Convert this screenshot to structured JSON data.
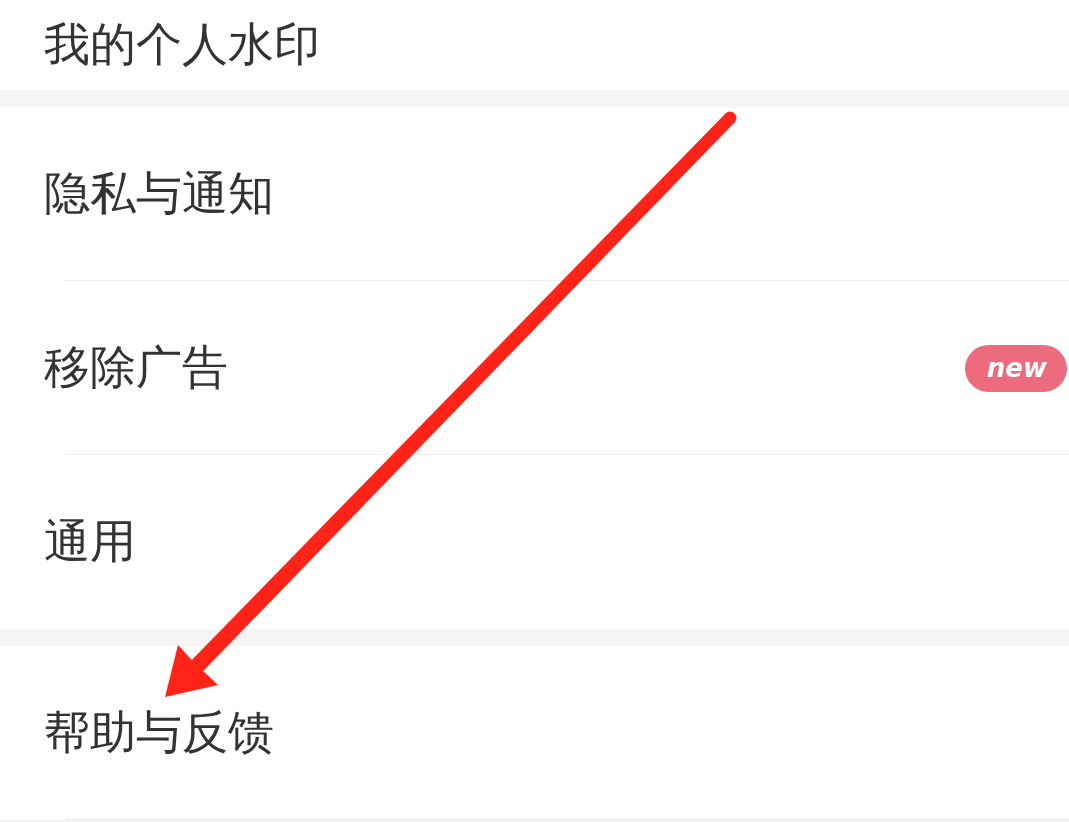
{
  "sections": [
    {
      "items": [
        {
          "label": "我的个人水印"
        }
      ]
    },
    {
      "items": [
        {
          "label": "隐私与通知"
        },
        {
          "label": "移除广告",
          "badge": "new"
        },
        {
          "label": "通用"
        }
      ]
    },
    {
      "items": [
        {
          "label": "帮助与反馈"
        }
      ]
    }
  ]
}
